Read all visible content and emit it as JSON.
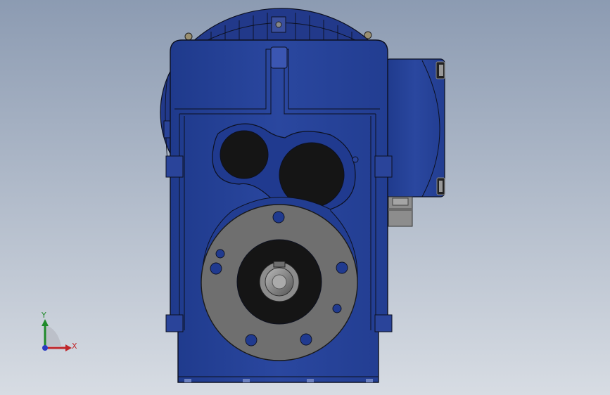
{
  "viewport": {
    "background_top": "#8e9db3",
    "background_bottom": "#d6dbe2",
    "part_color": "#27439b",
    "part_edge_color": "#0c1020",
    "flange_color": "#6f6f6f",
    "bore_color": "#141414"
  },
  "triad": {
    "y_label": "Y",
    "x_label": "X",
    "y_color": "#1f8a2a",
    "x_color": "#c0262a",
    "origin_color": "#2a3bc2"
  }
}
